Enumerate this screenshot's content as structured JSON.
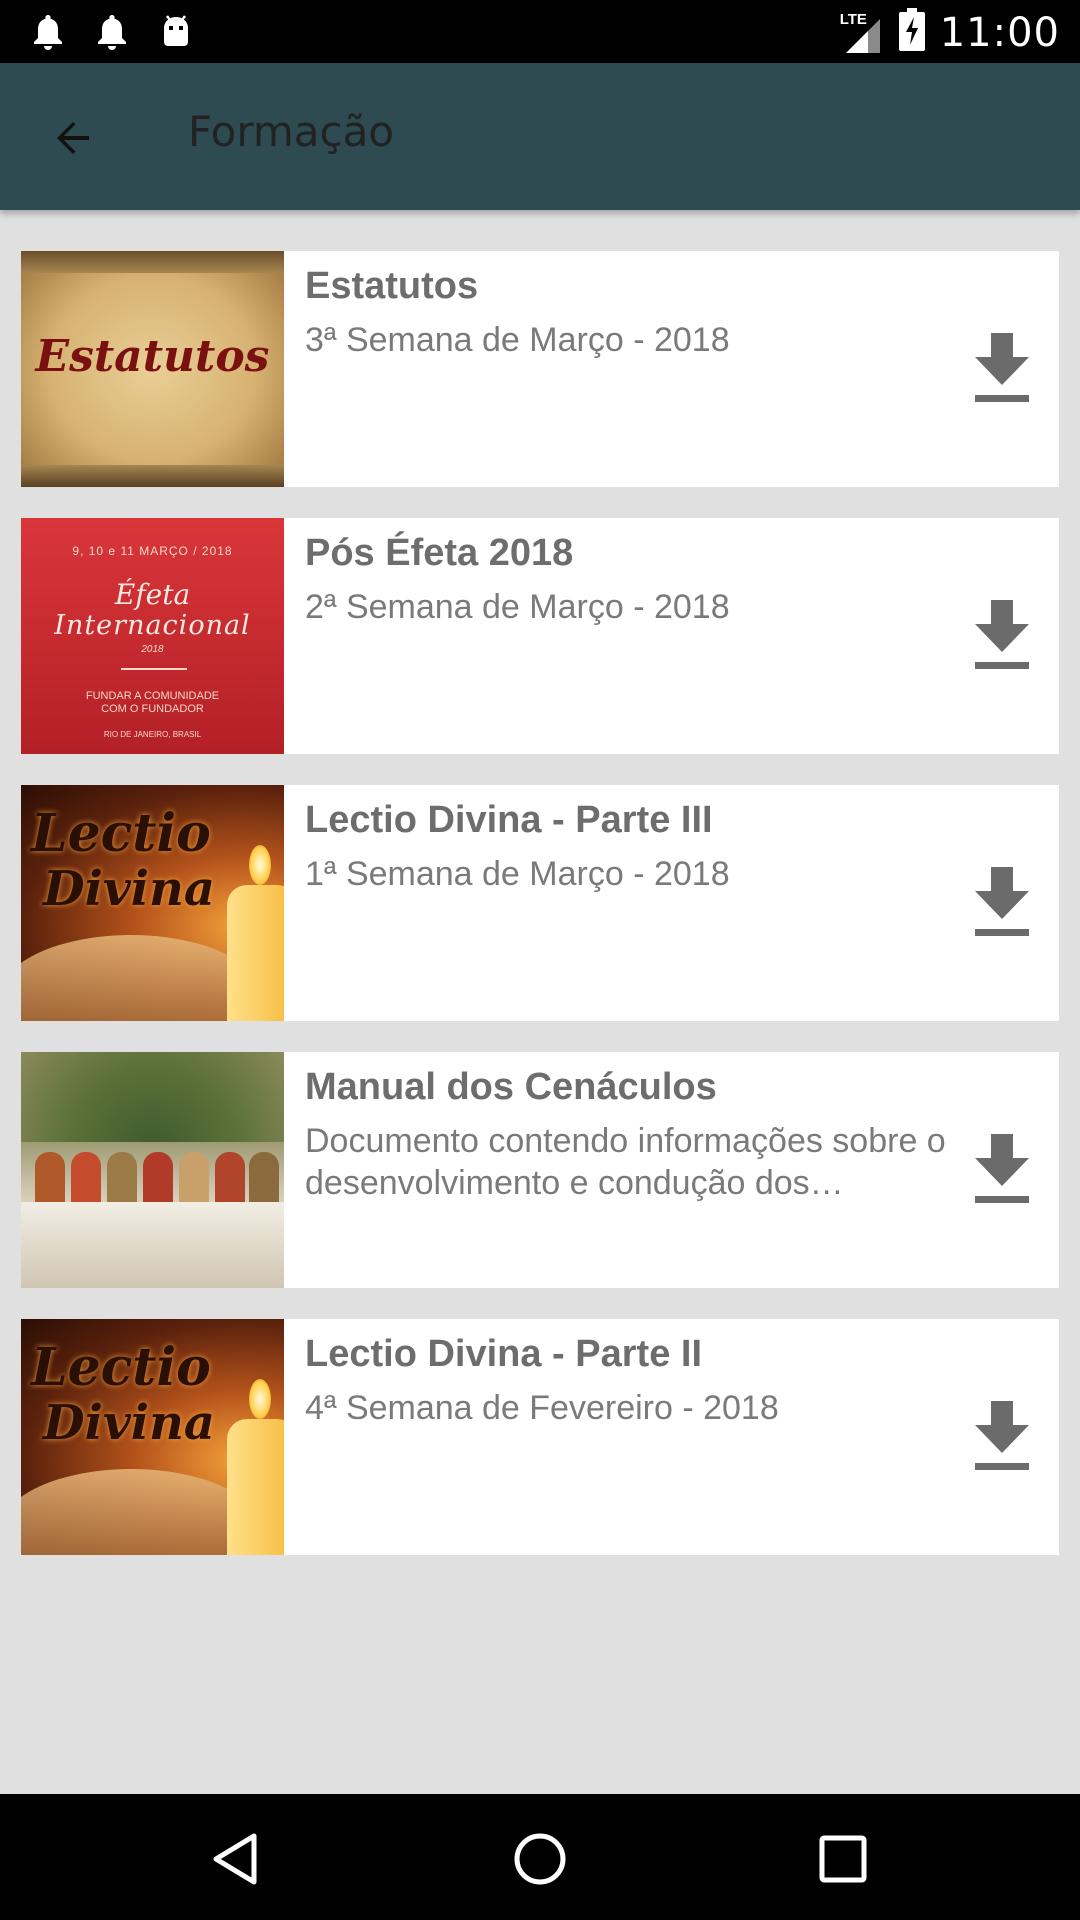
{
  "status_bar": {
    "time": "11:00",
    "network": "LTE",
    "left_icons": [
      "notification-bell-icon",
      "notification-bell-icon",
      "android-debug-icon"
    ],
    "right_icons": [
      "signal-icon",
      "battery-charging-icon"
    ]
  },
  "app_bar": {
    "title": "Formação",
    "back_icon": "arrow-back-icon",
    "color": "#2d4b51"
  },
  "items": [
    {
      "title": "Estatutos",
      "subtitle": "3ª Semana de Março - 2018",
      "thumbnail_text": "Estatutos",
      "action_icon": "download-icon"
    },
    {
      "title": "Pós Éfeta 2018",
      "subtitle": "2ª Semana de Março - 2018",
      "thumbnail_text": {
        "date": "9, 10 e 11 MARÇO / 2018",
        "line1": "Éfeta",
        "line2": "Internacional",
        "year": "2018",
        "sub1": "FUNDAR A COMUNIDADE",
        "sub2": "COM O FUNDADOR",
        "place": "RIO DE JANEIRO, BRASIL"
      },
      "action_icon": "download-icon"
    },
    {
      "title": "Lectio Divina - Parte III",
      "subtitle": "1ª Semana de Março - 2018",
      "thumbnail_text": {
        "line1": "Lectio",
        "line2": "Divina"
      },
      "action_icon": "download-icon"
    },
    {
      "title": "Manual dos Cenáculos",
      "subtitle": "Documento contendo informações sobre o desenvolvimento e condução dos Cenáculos",
      "action_icon": "download-icon"
    },
    {
      "title": "Lectio Divina - Parte II",
      "subtitle": "4ª Semana de Fevereiro - 2018",
      "thumbnail_text": {
        "line1": "Lectio",
        "line2": "Divina"
      },
      "action_icon": "download-icon"
    }
  ],
  "nav_bar": {
    "buttons": [
      "back-triangle-icon",
      "home-circle-icon",
      "recents-square-icon"
    ]
  }
}
